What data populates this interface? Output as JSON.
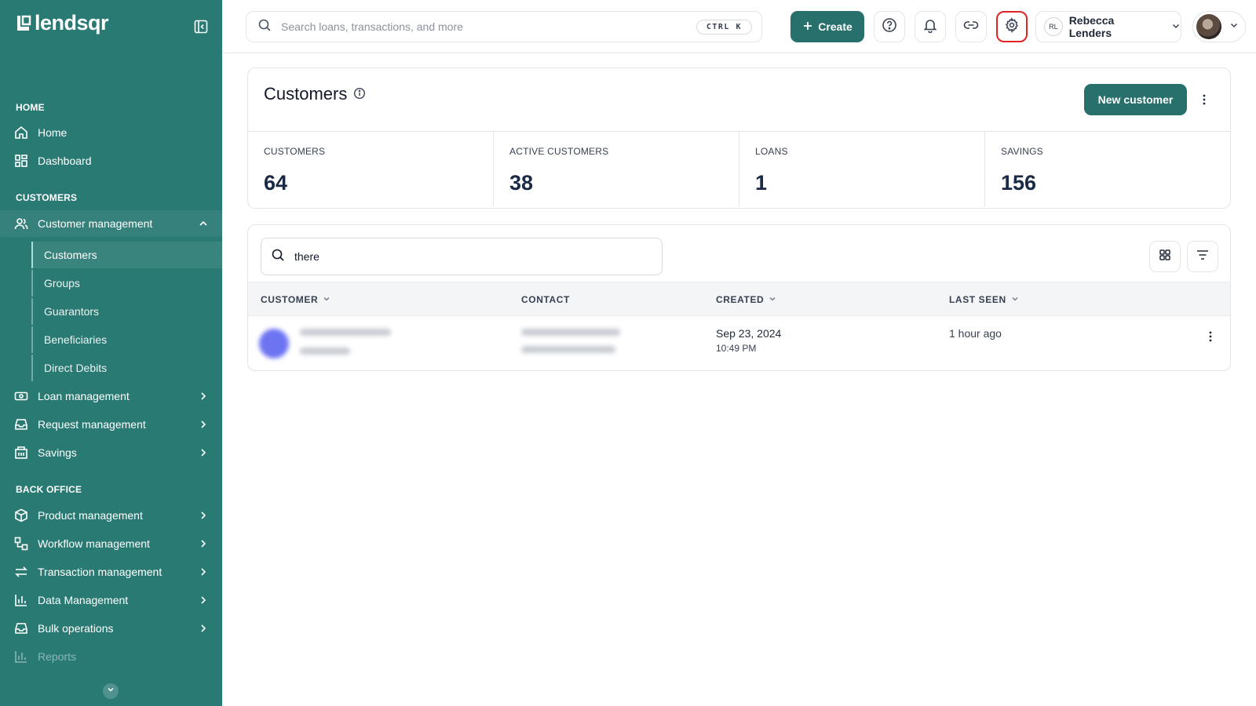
{
  "brand": {
    "name": "lendsqr"
  },
  "sidebar": {
    "sections": {
      "home": "HOME",
      "customers": "CUSTOMERS",
      "back_office": "BACK OFFICE"
    },
    "home_items": [
      "Home",
      "Dashboard"
    ],
    "customer_management": "Customer management",
    "customer_sub": [
      "Customers",
      "Groups",
      "Guarantors",
      "Beneficiaries",
      "Direct Debits"
    ],
    "customer_items": [
      "Loan management",
      "Request management",
      "Savings"
    ],
    "back_office_items": [
      "Product management",
      "Workflow management",
      "Transaction management",
      "Data Management",
      "Bulk operations",
      "Reports"
    ]
  },
  "topbar": {
    "search_placeholder": "Search loans, transactions, and more",
    "shortcut": "CTRL  K",
    "create_label": "Create",
    "user_initials": "RL",
    "user_name": "Rebecca Lenders"
  },
  "page": {
    "title": "Customers",
    "new_customer_label": "New customer",
    "stats": [
      {
        "label": "CUSTOMERS",
        "value": "64"
      },
      {
        "label": "ACTIVE CUSTOMERS",
        "value": "38"
      },
      {
        "label": "LOANS",
        "value": "1"
      },
      {
        "label": "SAVINGS",
        "value": "156"
      }
    ]
  },
  "table": {
    "search_value": "there",
    "columns": [
      "CUSTOMER",
      "CONTACT",
      "CREATED",
      "LAST SEEN"
    ],
    "rows": [
      {
        "created_date": "Sep 23, 2024",
        "created_time": "10:49 PM",
        "last_seen": "1 hour ago"
      }
    ]
  },
  "colors": {
    "sidebar": "#2a7a74",
    "primary": "#27706b",
    "highlight": "#e02424"
  }
}
